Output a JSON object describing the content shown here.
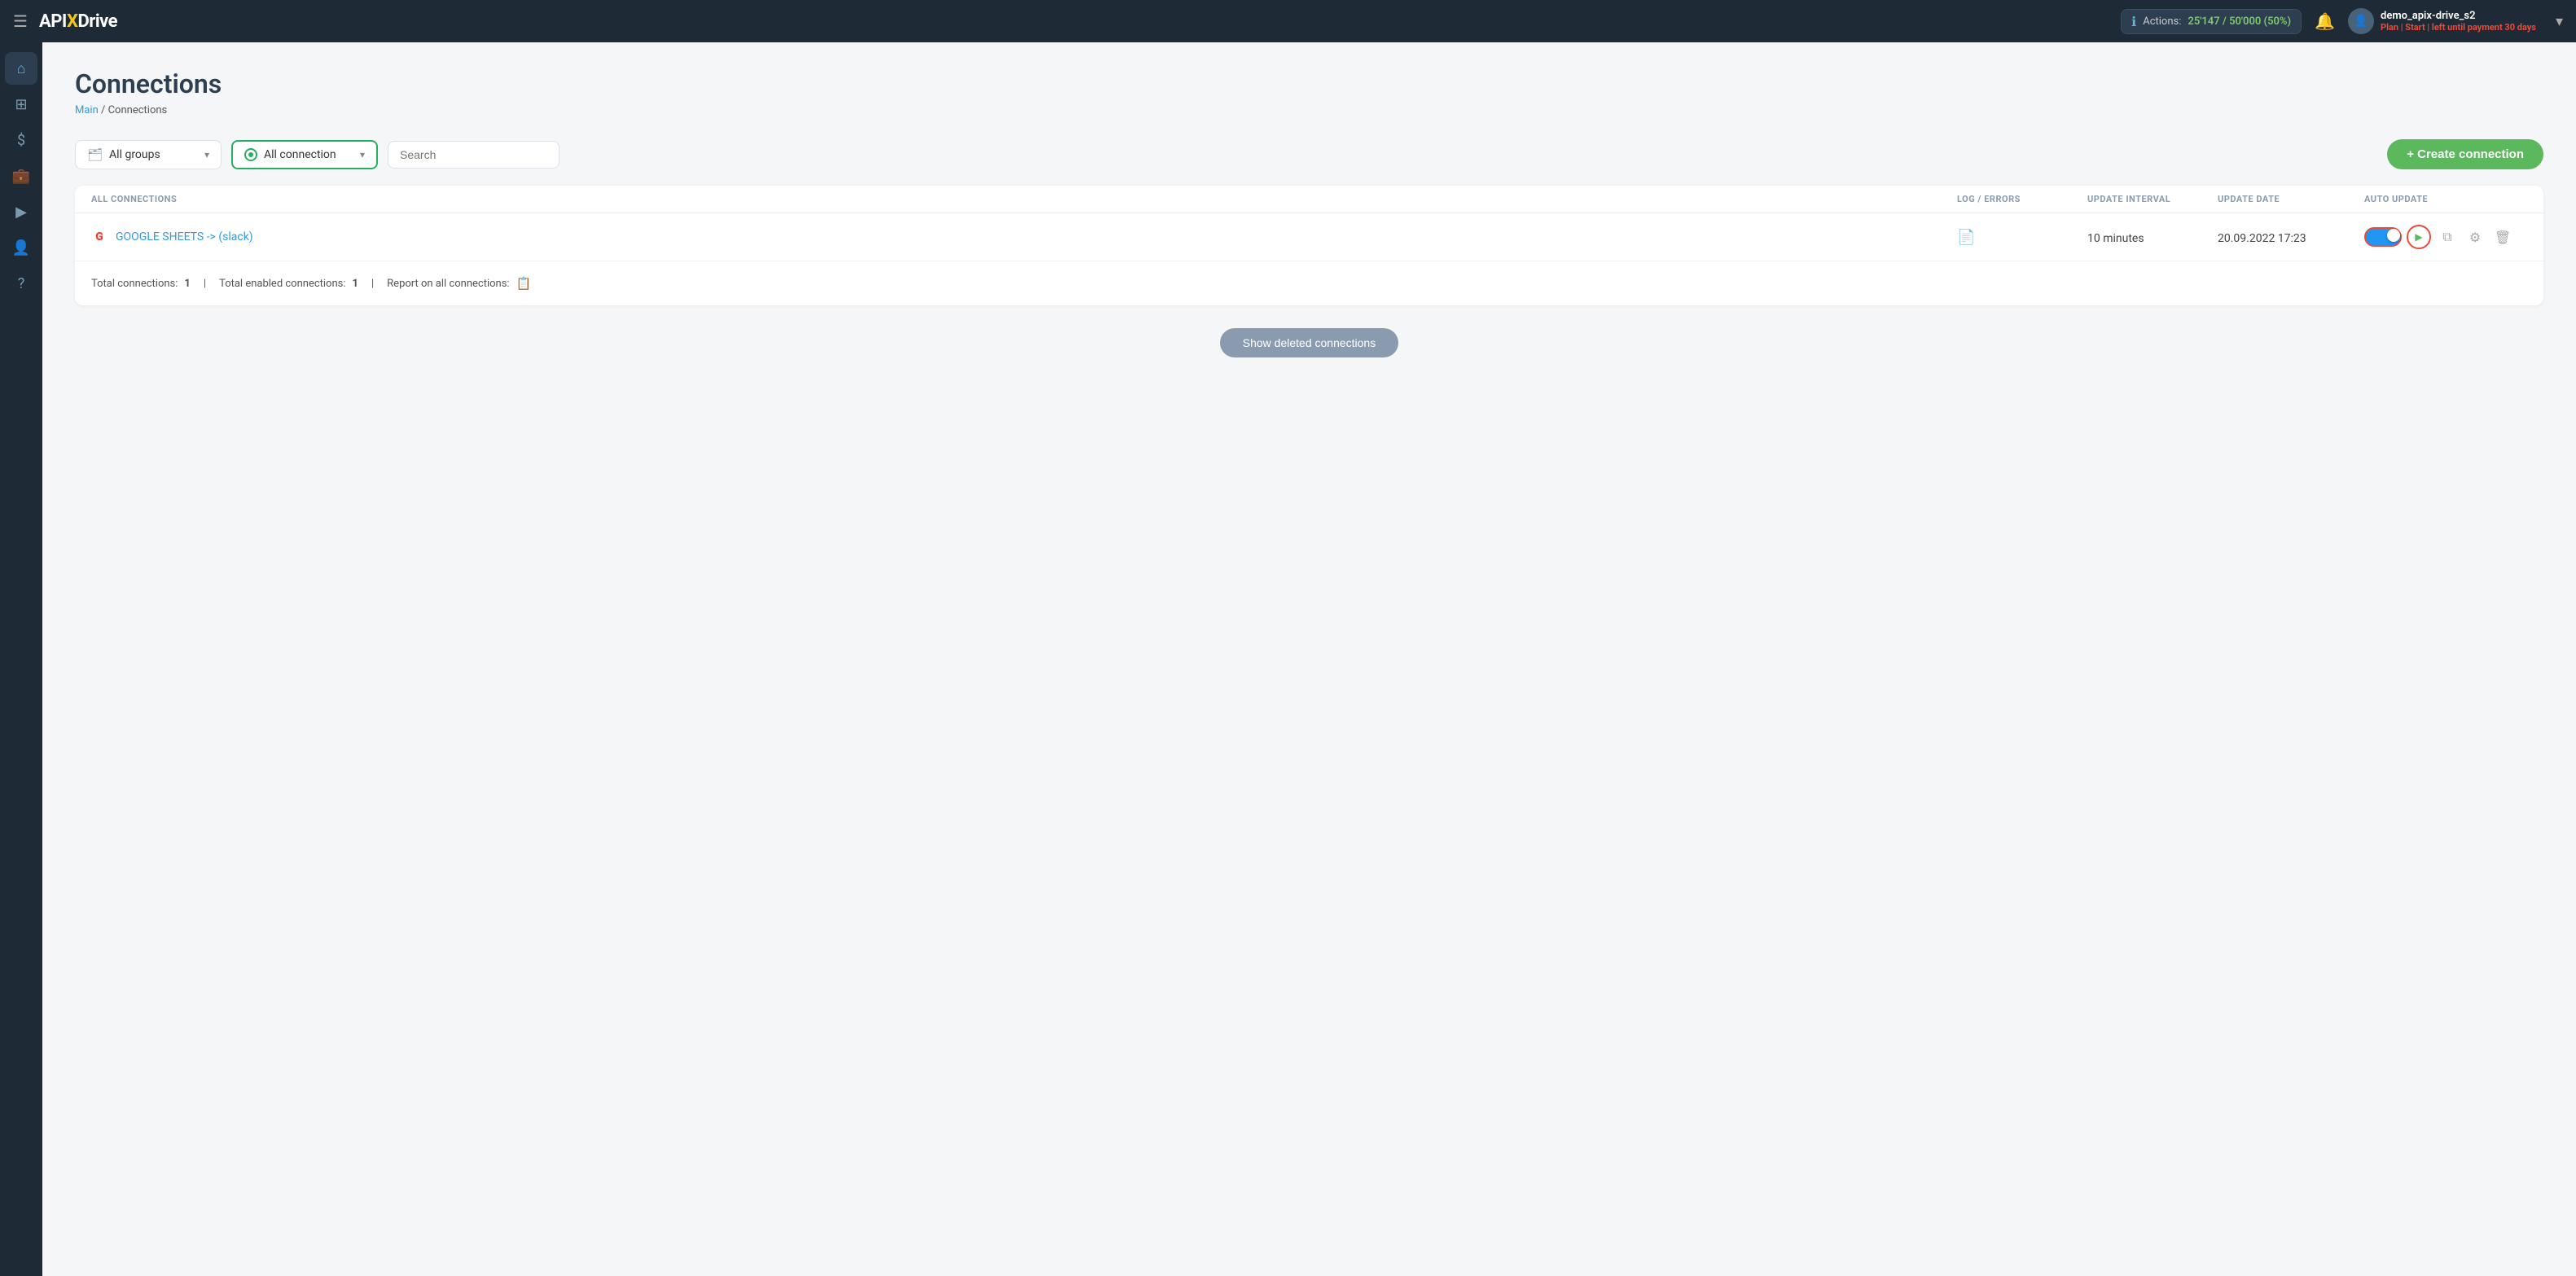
{
  "topnav": {
    "hamburger": "☰",
    "logo_api": "API",
    "logo_x": "X",
    "logo_drive": "Drive",
    "actions_label": "Actions:",
    "actions_value": "25'147 / 50'000 (50%)",
    "bell_icon": "🔔",
    "user_name": "demo_apix-drive_s2",
    "user_plan": "Plan | Start | left until payment",
    "user_days": "30",
    "user_days_suffix": " days",
    "chevron": "▾"
  },
  "sidebar": {
    "items": [
      {
        "icon": "⌂",
        "label": "home-icon"
      },
      {
        "icon": "⊞",
        "label": "grid-icon"
      },
      {
        "icon": "$",
        "label": "billing-icon"
      },
      {
        "icon": "💼",
        "label": "briefcase-icon"
      },
      {
        "icon": "▶",
        "label": "play-icon"
      },
      {
        "icon": "👤",
        "label": "user-icon"
      },
      {
        "icon": "?",
        "label": "help-icon"
      }
    ]
  },
  "page": {
    "title": "Connections",
    "breadcrumb_main": "Main",
    "breadcrumb_sep": " / ",
    "breadcrumb_current": "Connections"
  },
  "toolbar": {
    "groups_label": "All groups",
    "connections_label": "All connection",
    "search_placeholder": "Search",
    "create_btn": "+ Create connection"
  },
  "table": {
    "headers": [
      "ALL CONNECTIONS",
      "LOG / ERRORS",
      "UPDATE INTERVAL",
      "UPDATE DATE",
      "AUTO UPDATE"
    ],
    "rows": [
      {
        "name": "GOOGLE SHEETS -> (slack)",
        "log_icon": "📄",
        "interval": "10 minutes",
        "date": "20.09.2022 17:23",
        "enabled": true
      }
    ]
  },
  "footer": {
    "total_connections_label": "Total connections:",
    "total_connections_value": "1",
    "total_enabled_label": "Total enabled connections:",
    "total_enabled_value": "1",
    "report_label": "Report on all connections:"
  },
  "show_deleted": {
    "button_label": "Show deleted connections"
  }
}
